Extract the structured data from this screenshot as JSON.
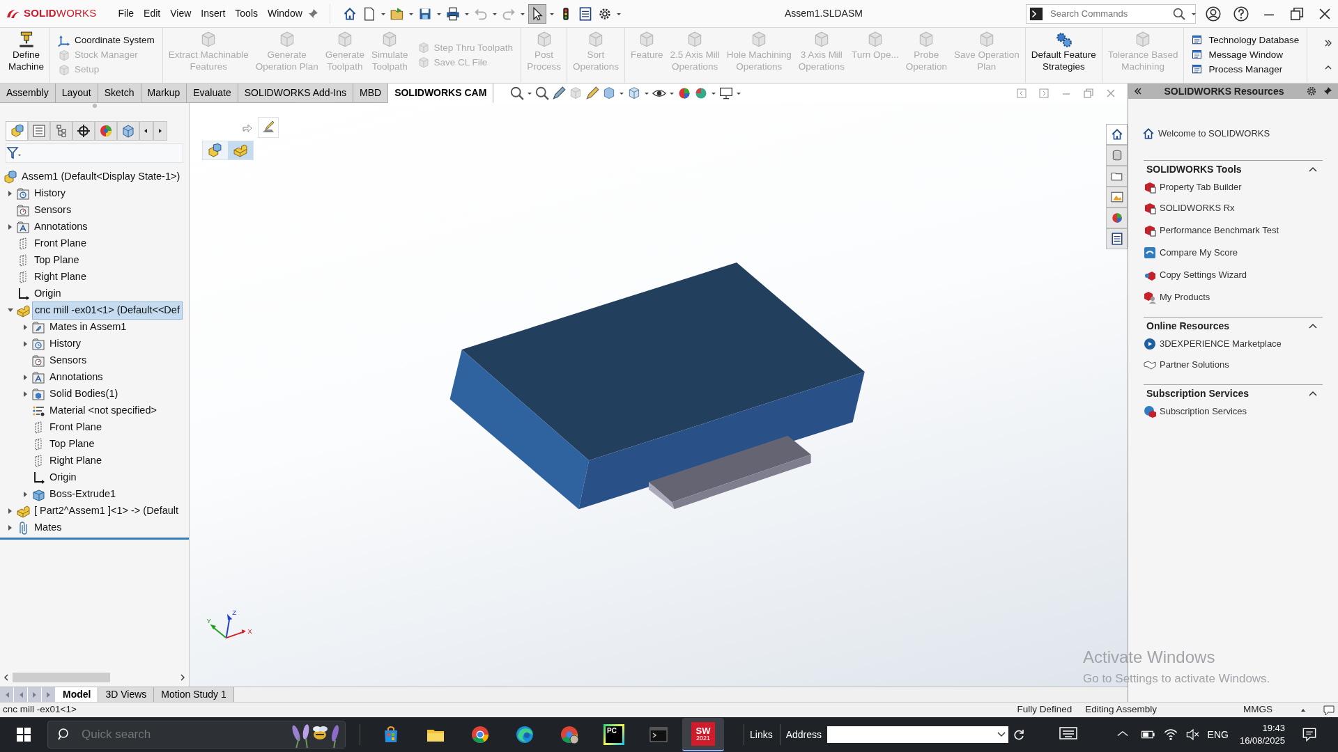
{
  "app": {
    "logo": "**SOLID**WORKS",
    "menu": [
      "File",
      "Edit",
      "View",
      "Insert",
      "Tools",
      "Window"
    ],
    "document_title": "Assem1.SLDASM",
    "search": {
      "placeholder": "Search Commands"
    }
  },
  "ribbon": {
    "groups": [
      [
        {
          "kind": "large",
          "label": "Define\nMachine",
          "disabled": false
        }
      ],
      [
        {
          "kind": "small",
          "label": "Coordinate System",
          "disabled": false
        },
        {
          "kind": "small",
          "label": "Stock Manager",
          "disabled": true
        },
        {
          "kind": "small",
          "label": "Setup",
          "disabled": true
        }
      ],
      [
        {
          "kind": "large",
          "label": "Extract Machinable\nFeatures",
          "disabled": true
        },
        {
          "kind": "large",
          "label": "Generate\nOperation Plan",
          "disabled": true
        },
        {
          "kind": "large",
          "label": "Generate\nToolpath",
          "disabled": true
        },
        {
          "kind": "large",
          "label": "Simulate\nToolpath",
          "disabled": true
        },
        {
          "kind": "small",
          "label": "Step Thru Toolpath",
          "disabled": true
        },
        {
          "kind": "small",
          "label": "Save CL File",
          "disabled": true
        }
      ],
      [
        {
          "kind": "large",
          "label": "Post\nProcess",
          "disabled": true
        }
      ],
      [
        {
          "kind": "large",
          "label": "Sort\nOperations",
          "disabled": true
        }
      ],
      [
        {
          "kind": "large",
          "label": "Feature",
          "disabled": true
        },
        {
          "kind": "large",
          "label": "2.5 Axis Mill\nOperations",
          "disabled": true
        },
        {
          "kind": "large",
          "label": "Hole Machining\nOperations",
          "disabled": true
        },
        {
          "kind": "large",
          "label": "3 Axis Mill\nOperations",
          "disabled": true
        },
        {
          "kind": "large",
          "label": "Turn Ope...",
          "disabled": true
        },
        {
          "kind": "large",
          "label": "Probe\nOperation",
          "disabled": true
        },
        {
          "kind": "large",
          "label": "Save Operation\nPlan",
          "disabled": true
        }
      ],
      [
        {
          "kind": "large",
          "label": "Default Feature\nStrategies",
          "disabled": false
        }
      ],
      [
        {
          "kind": "large",
          "label": "Tolerance Based\nMachining",
          "disabled": true
        }
      ],
      [
        {
          "kind": "small",
          "label": "Technology Database",
          "disabled": false
        },
        {
          "kind": "small",
          "label": "Message Window",
          "disabled": false
        },
        {
          "kind": "small",
          "label": "Process Manager",
          "disabled": false
        }
      ]
    ]
  },
  "tabs": [
    {
      "label": "Assembly",
      "selected": false
    },
    {
      "label": "Layout",
      "selected": false
    },
    {
      "label": "Sketch",
      "selected": false
    },
    {
      "label": "Markup",
      "selected": false
    },
    {
      "label": "Evaluate",
      "selected": false
    },
    {
      "label": "SOLIDWORKS Add-Ins",
      "selected": false
    },
    {
      "label": "MBD",
      "selected": false
    },
    {
      "label": "SOLIDWORKS CAM",
      "selected": true
    }
  ],
  "feature_manager": {
    "panel_tabs": [
      {
        "selected": true
      },
      {
        "selected": false
      },
      {
        "selected": false
      },
      {
        "selected": false
      },
      {
        "selected": false
      },
      {
        "selected": false
      }
    ],
    "tree": [
      {
        "label": "Assem1  (Default<Display State-1>)",
        "kind": "assembly",
        "selected": false,
        "children": [
          {
            "label": "History",
            "kind": "history",
            "expanded": false,
            "selected": false
          },
          {
            "label": "Sensors",
            "kind": "sensors",
            "selected": false
          },
          {
            "label": "Annotations",
            "kind": "annotations",
            "expanded": false,
            "selected": false
          },
          {
            "label": "Front Plane",
            "kind": "plane",
            "selected": false
          },
          {
            "label": "Top Plane",
            "kind": "plane",
            "selected": false
          },
          {
            "label": "Right Plane",
            "kind": "plane",
            "selected": false
          },
          {
            "label": "Origin",
            "kind": "origin",
            "selected": false
          },
          {
            "label": "cnc mill -ex01<1> (Default<<Def",
            "kind": "part",
            "expanded": true,
            "selected": true,
            "children": [
              {
                "label": "Mates in Assem1",
                "kind": "mates_folder",
                "expanded": false,
                "selected": false
              },
              {
                "label": "History",
                "kind": "history",
                "expanded": false,
                "selected": false
              },
              {
                "label": "Sensors",
                "kind": "sensors",
                "selected": false
              },
              {
                "label": "Annotations",
                "kind": "annotations",
                "expanded": false,
                "selected": false
              },
              {
                "label": "Solid Bodies(1)",
                "kind": "bodies",
                "expanded": false,
                "selected": false
              },
              {
                "label": "Material <not specified>",
                "kind": "material",
                "selected": false
              },
              {
                "label": "Front Plane",
                "kind": "plane",
                "selected": false
              },
              {
                "label": "Top Plane",
                "kind": "plane",
                "selected": false
              },
              {
                "label": "Right Plane",
                "kind": "plane",
                "selected": false
              },
              {
                "label": "Origin",
                "kind": "origin",
                "selected": false
              },
              {
                "label": "Boss-Extrude1",
                "kind": "feature",
                "expanded": false,
                "selected": false
              }
            ]
          },
          {
            "label": "[ Part2^Assem1 ]<1> -> (Default",
            "kind": "part",
            "expanded": false,
            "selected": false
          },
          {
            "label": "Mates",
            "kind": "mates",
            "expanded": false,
            "selected": false
          }
        ]
      }
    ]
  },
  "viewport": {
    "triad_labels": [
      "Z",
      "Y",
      "X"
    ]
  },
  "task_pane": {
    "title": "SOLIDWORKS Resources",
    "strip": [
      {
        "selected": true
      },
      {
        "selected": false
      },
      {
        "selected": false
      },
      {
        "selected": false
      },
      {
        "selected": false
      },
      {
        "selected": false
      }
    ],
    "welcome": "Welcome to SOLIDWORKS",
    "sections": [
      {
        "title": "SOLIDWORKS Tools",
        "expanded": true,
        "items": [
          "Property Tab Builder",
          "SOLIDWORKS Rx",
          "Performance Benchmark Test",
          "Compare My Score",
          "Copy Settings Wizard",
          "My Products"
        ]
      },
      {
        "title": "Online Resources",
        "expanded": true,
        "items": [
          "3DEXPERIENCE Marketplace",
          "Partner Solutions"
        ]
      },
      {
        "title": "Subscription Services",
        "expanded": true,
        "items": [
          "Subscription Services"
        ]
      }
    ]
  },
  "bottom_tabs": [
    {
      "label": "Model",
      "selected": true
    },
    {
      "label": "3D Views",
      "selected": false
    },
    {
      "label": "Motion Study 1",
      "selected": false
    }
  ],
  "status_bar": {
    "selection": "cnc mill -ex01<1>",
    "state": "Fully Defined",
    "mode": "Editing Assembly",
    "units": "MMGS"
  },
  "os_notice": {
    "title": "Activate Windows",
    "hint": "Go to Settings to activate Windows."
  },
  "taskbar": {
    "search": {
      "placeholder": "Quick search"
    },
    "apps": [
      {
        "kind": "store",
        "selected": false
      },
      {
        "kind": "explorer",
        "selected": false
      },
      {
        "kind": "chrome",
        "selected": false
      },
      {
        "kind": "edge",
        "selected": false
      },
      {
        "kind": "chrome_profile",
        "selected": false
      },
      {
        "kind": "pycharm",
        "text": "PC",
        "selected": false
      },
      {
        "kind": "terminal",
        "selected": false
      },
      {
        "kind": "solidworks",
        "text": "SW",
        "caption": "2021",
        "selected": true
      }
    ],
    "links": "Links",
    "address_label": "Address",
    "language": "ENG",
    "time": "19:43",
    "date": "16/08/2025"
  }
}
